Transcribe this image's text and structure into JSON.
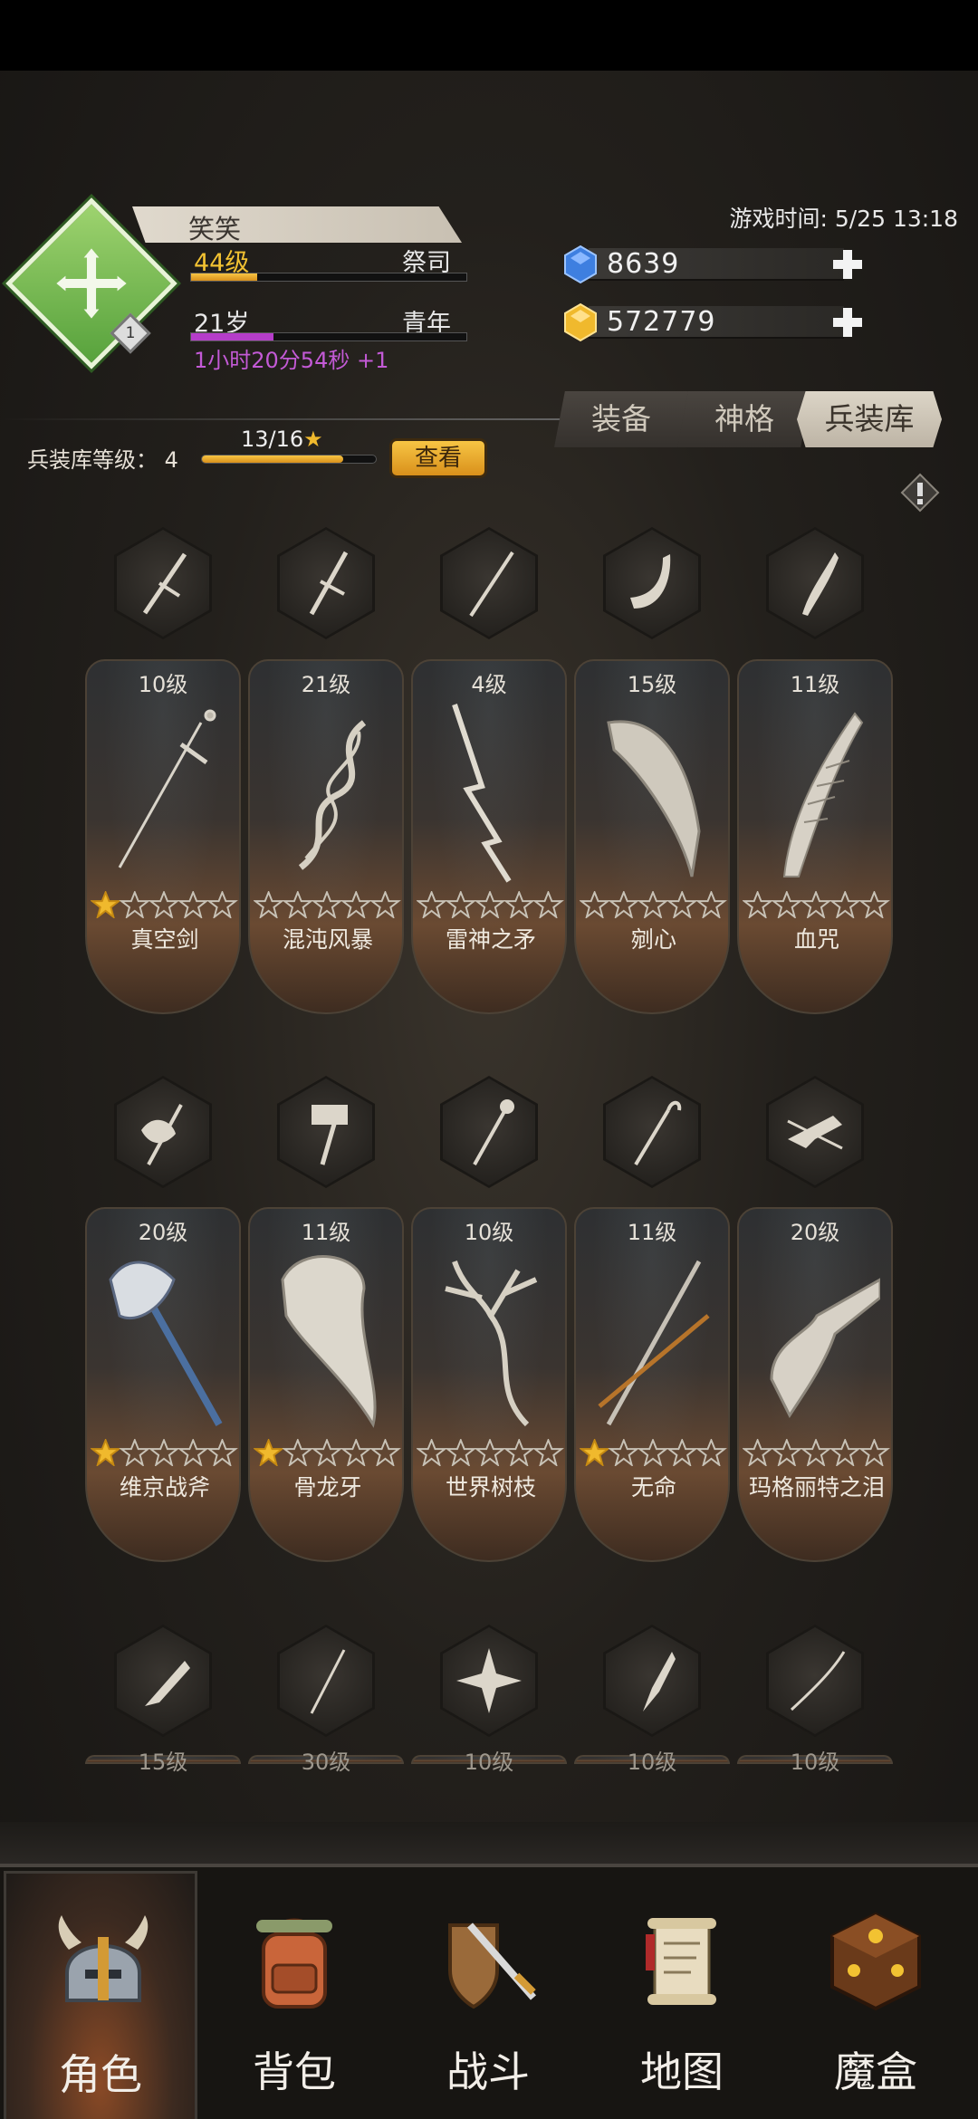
{
  "player": {
    "name": "笑笑",
    "level": "44级",
    "class": "祭司",
    "age": "21岁",
    "life_stage": "青年",
    "timer": "1小时20分54秒 +1",
    "rank": "1",
    "level_progress": 0.24,
    "age_progress": 0.3
  },
  "game_time": "游戏时间: 5/25 13:18",
  "currencies": [
    {
      "name": "gem",
      "value": "8639",
      "color": "#3e7fe0"
    },
    {
      "name": "gold",
      "value": "572779",
      "color": "#f0b92d"
    }
  ],
  "tabs": [
    "装备",
    "神格",
    "兵装库"
  ],
  "active_tab": "兵装库",
  "armory": {
    "label": "兵装库等级：",
    "level": "4",
    "progress_text": "13/16",
    "progress": 0.8125,
    "view_button": "查看"
  },
  "weapon_rows": [
    [
      {
        "level": "10级",
        "name": "真空剑",
        "stars": 1,
        "icon": "sword-icon"
      },
      {
        "level": "21级",
        "name": "混沌风暴",
        "stars": 0,
        "icon": "twisted-blade-icon"
      },
      {
        "level": "4级",
        "name": "雷神之矛",
        "stars": 0,
        "icon": "lightning-spear-icon"
      },
      {
        "level": "15级",
        "name": "剜心",
        "stars": 0,
        "icon": "curved-blade-icon"
      },
      {
        "level": "11级",
        "name": "血咒",
        "stars": 0,
        "icon": "bone-dagger-icon"
      }
    ],
    [
      {
        "level": "20级",
        "name": "维京战斧",
        "stars": 1,
        "icon": "battle-axe-icon"
      },
      {
        "level": "11级",
        "name": "骨龙牙",
        "stars": 1,
        "icon": "bone-fang-icon"
      },
      {
        "level": "10级",
        "name": "世界树枝",
        "stars": 0,
        "icon": "tree-branch-icon"
      },
      {
        "level": "11级",
        "name": "无命",
        "stars": 1,
        "icon": "cane-sword-icon"
      },
      {
        "level": "20级",
        "name": "玛格丽特之泪",
        "stars": 0,
        "icon": "flintlock-pistol-icon"
      }
    ]
  ],
  "third_row_icons": [
    "flintlock-icon",
    "rapier-icon",
    "shuriken-icon",
    "broad-dagger-icon",
    "katana-icon"
  ],
  "third_row_levels": [
    "15级",
    "30级",
    "10级",
    "10级",
    "10级"
  ],
  "nav": [
    {
      "label": "角色",
      "icon": "helmet-icon",
      "active": true
    },
    {
      "label": "背包",
      "icon": "backpack-icon",
      "active": false
    },
    {
      "label": "战斗",
      "icon": "sword-shield-icon",
      "active": false
    },
    {
      "label": "地图",
      "icon": "scroll-map-icon",
      "active": false
    },
    {
      "label": "魔盒",
      "icon": "magic-box-icon",
      "active": false
    }
  ]
}
